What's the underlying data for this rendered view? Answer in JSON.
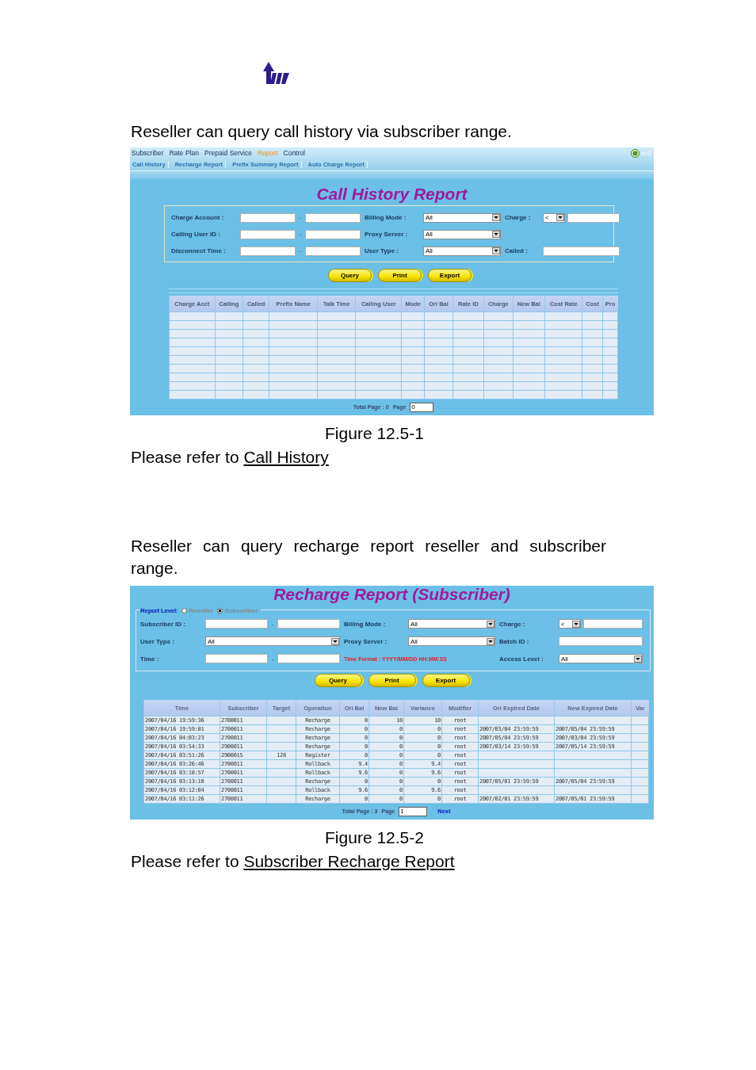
{
  "sections": [
    {
      "intro": "Reseller can query call history via subscriber range.",
      "screen": {
        "menu": [
          {
            "label": "Subscriber",
            "selected": false
          },
          {
            "label": "Rate Plan",
            "selected": false
          },
          {
            "label": "Prepaid Service",
            "selected": false
          },
          {
            "label": "Report",
            "selected": true
          },
          {
            "label": "Control",
            "selected": false
          }
        ],
        "submenu": [
          {
            "label": "Call History",
            "selected": false
          },
          {
            "label": "Recharge Report",
            "selected": false
          },
          {
            "label": "Prefix Summary Report",
            "selected": false
          },
          {
            "label": "Auto Charge Report",
            "selected": false
          }
        ],
        "badge": "#22",
        "title": "Call History Report",
        "filter_rows": [
          [
            {
              "kind": "range",
              "label": "Charge Account :",
              "separator": "-"
            },
            {
              "kind": "select",
              "label": "Billing Mode :",
              "value": "All"
            },
            {
              "kind": "compare",
              "label": "Charge :",
              "value": "<"
            }
          ],
          [
            {
              "kind": "range",
              "label": "Calling User ID :",
              "separator": "-"
            },
            {
              "kind": "select",
              "label": "Proxy Server :",
              "value": "All"
            }
          ],
          [
            {
              "kind": "range",
              "label": "Disconnect Time :",
              "separator": "-"
            },
            {
              "kind": "select",
              "label": "User Type :",
              "value": "All"
            },
            {
              "kind": "text",
              "label": "Called :"
            }
          ]
        ],
        "buttons": [
          "Query",
          "Print",
          "Export"
        ],
        "table": {
          "columns": [
            "Charge Acct",
            "Calling",
            "Called",
            "Prefix Name",
            "Talk Time",
            "Calling User",
            "Mode",
            "Ori Bal",
            "Rate ID",
            "Charge",
            "New Bal",
            "Cost Rate",
            "Cost",
            "Pro"
          ]
        },
        "pager": {
          "total": "Total Page : 0",
          "page_label": "Page",
          "page_value": "0"
        }
      },
      "caption": "Figure 12.5-1",
      "reference": {
        "text": "Please refer to",
        "link": "Call History"
      }
    },
    {
      "intro": "Reseller can query recharge report reseller and subscriber range.",
      "screen": {
        "title": "Recharge Report (Subscriber)",
        "report_level": {
          "label": "Report Level:",
          "options": [
            {
              "label": "Reseller",
              "selected": false
            },
            {
              "label": "Subscriber",
              "selected": true
            }
          ]
        },
        "filter_rows": [
          [
            {
              "kind": "range",
              "label": "Subscriber ID :",
              "separator": "-"
            },
            {
              "kind": "select",
              "label": "Billing Mode :",
              "value": "All"
            },
            {
              "kind": "compare",
              "label": "Charge :",
              "value": "<"
            }
          ],
          [
            {
              "kind": "select",
              "label": "User Type :",
              "value": "All"
            },
            {
              "kind": "select",
              "label": "Proxy Server :",
              "value": "All"
            },
            {
              "kind": "text",
              "label": "Batch ID :"
            }
          ],
          [
            {
              "kind": "range",
              "label": "Time :",
              "separator": "-"
            },
            {
              "kind": "note",
              "text": "Time Format : YYYY/MM/DD HH:MM:SS"
            },
            {
              "kind": "select",
              "label": "Access Level :",
              "value": "All"
            }
          ]
        ],
        "buttons": [
          "Query",
          "Print",
          "Export"
        ],
        "table": {
          "columns": [
            "Time",
            "Subscriber",
            "Target",
            "Operation",
            "Ori Bal",
            "New Bal",
            "Variance",
            "Modifier",
            "Ori Expired Date",
            "New Expired Date",
            "Var"
          ],
          "rows": [
            [
              "2007/04/16 19:59:36",
              "2700011",
              null,
              "Recharge",
              "0",
              "10",
              "10",
              "root",
              null,
              null
            ],
            [
              "2007/04/16 19:59:01",
              "2700011",
              null,
              "Recharge",
              "0",
              "0",
              "0",
              "root",
              "2007/03/04 23:59:59",
              "2007/05/04 23:59:59"
            ],
            [
              "2007/04/16 04:03:23",
              "2700011",
              null,
              "Recharge",
              "0",
              "0",
              "0",
              "root",
              "2007/05/04 23:59:59",
              "2007/03/04 23:59:59"
            ],
            [
              "2007/04/16 03:54:33",
              "2900011",
              null,
              "Recharge",
              "0",
              "0",
              "0",
              "root",
              "2007/03/14 23:59:59",
              "2007/05/14 23:59:59"
            ],
            [
              "2007/04/16 03:51:26",
              "2900015",
              "128",
              "Register",
              "0",
              "0",
              "0",
              "root",
              null,
              null
            ],
            [
              "2007/04/16 03:26:46",
              "2700011",
              null,
              "Rollback",
              "9.4",
              "0",
              "9.4",
              "root",
              null,
              null
            ],
            [
              "2007/04/16 03:18:57",
              "2700011",
              null,
              "Rollback",
              "9.6",
              "0",
              "9.6",
              "root",
              null,
              null
            ],
            [
              "2007/04/16 03:13:10",
              "2700011",
              null,
              "Recharge",
              "0",
              "0",
              "0",
              "root",
              "2007/05/01 23:59:59",
              "2007/05/04 23:59:59"
            ],
            [
              "2007/04/16 03:12:04",
              "2700011",
              null,
              "Rollback",
              "9.6",
              "0",
              "9.6",
              "root",
              null,
              null
            ],
            [
              "2007/04/16 03:11:26",
              "2700011",
              null,
              "Recharge",
              "0",
              "0",
              "0",
              "root",
              "2007/02/01 23:59:59",
              "2007/05/01 23:59:59"
            ]
          ]
        },
        "pager": {
          "total": "Total Page : 3",
          "page_label": "Page",
          "page_value": "1",
          "next": "Next"
        }
      },
      "caption": "Figure 12.5-2",
      "reference": {
        "text": "Please refer to",
        "link": "Subscriber Recharge Report"
      }
    }
  ]
}
